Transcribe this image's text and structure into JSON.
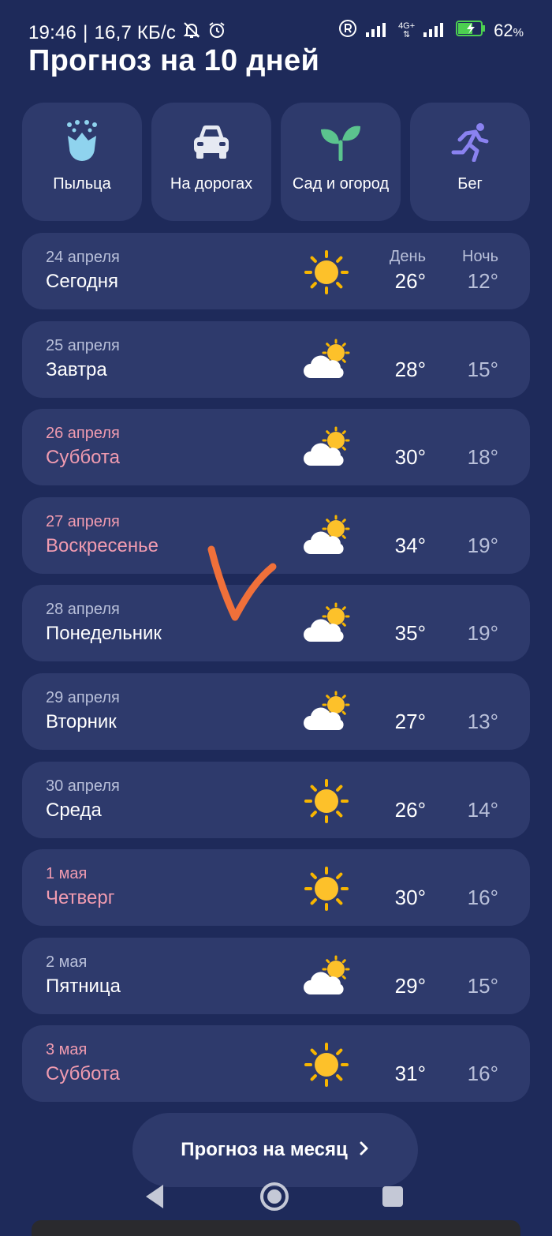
{
  "status_bar": {
    "time": "19:46",
    "speed": "16,7 КБ/с",
    "network": "4G+",
    "battery": "62"
  },
  "title": "Прогноз на 10 дней",
  "tiles": [
    {
      "label": "Пыльца",
      "icon": "flower-icon"
    },
    {
      "label": "На дорогах",
      "icon": "car-icon"
    },
    {
      "label": "Сад и огород",
      "icon": "sprout-icon"
    },
    {
      "label": "Бег",
      "icon": "runner-icon"
    }
  ],
  "columns": {
    "day": "День",
    "night": "Ночь"
  },
  "days": [
    {
      "date": "24 апреля",
      "name": "Сегодня",
      "day": "26°",
      "night": "12°",
      "icon": "sun-icon",
      "weekend": false
    },
    {
      "date": "25 апреля",
      "name": "Завтра",
      "day": "28°",
      "night": "15°",
      "icon": "partly-cloudy-icon",
      "weekend": false
    },
    {
      "date": "26 апреля",
      "name": "Суббота",
      "day": "30°",
      "night": "18°",
      "icon": "partly-cloudy-icon",
      "weekend": true
    },
    {
      "date": "27 апреля",
      "name": "Воскресенье",
      "day": "34°",
      "night": "19°",
      "icon": "partly-cloudy-icon",
      "weekend": true
    },
    {
      "date": "28 апреля",
      "name": "Понедельник",
      "day": "35°",
      "night": "19°",
      "icon": "partly-cloudy-icon",
      "weekend": false
    },
    {
      "date": "29 апреля",
      "name": "Вторник",
      "day": "27°",
      "night": "13°",
      "icon": "partly-cloudy-icon",
      "weekend": false
    },
    {
      "date": "30 апреля",
      "name": "Среда",
      "day": "26°",
      "night": "14°",
      "icon": "sun-icon",
      "weekend": false
    },
    {
      "date": "1 мая",
      "name": "Четверг",
      "day": "30°",
      "night": "16°",
      "icon": "sun-icon",
      "weekend": true
    },
    {
      "date": "2 мая",
      "name": "Пятница",
      "day": "29°",
      "night": "15°",
      "icon": "partly-cloudy-icon",
      "weekend": false
    },
    {
      "date": "3 мая",
      "name": "Суббота",
      "day": "31°",
      "night": "16°",
      "icon": "sun-icon",
      "weekend": true
    }
  ],
  "month_button": {
    "label": "Прогноз на месяц",
    "icon": "chevron-right-icon"
  },
  "nav": [
    "back-icon",
    "home-icon",
    "recents-icon"
  ],
  "colors": {
    "background": "#1e2a5a",
    "card": "#2e3a6c",
    "weekend": "#f09bb0",
    "muted": "#b8bfd9",
    "annotation": "#f0703a"
  }
}
